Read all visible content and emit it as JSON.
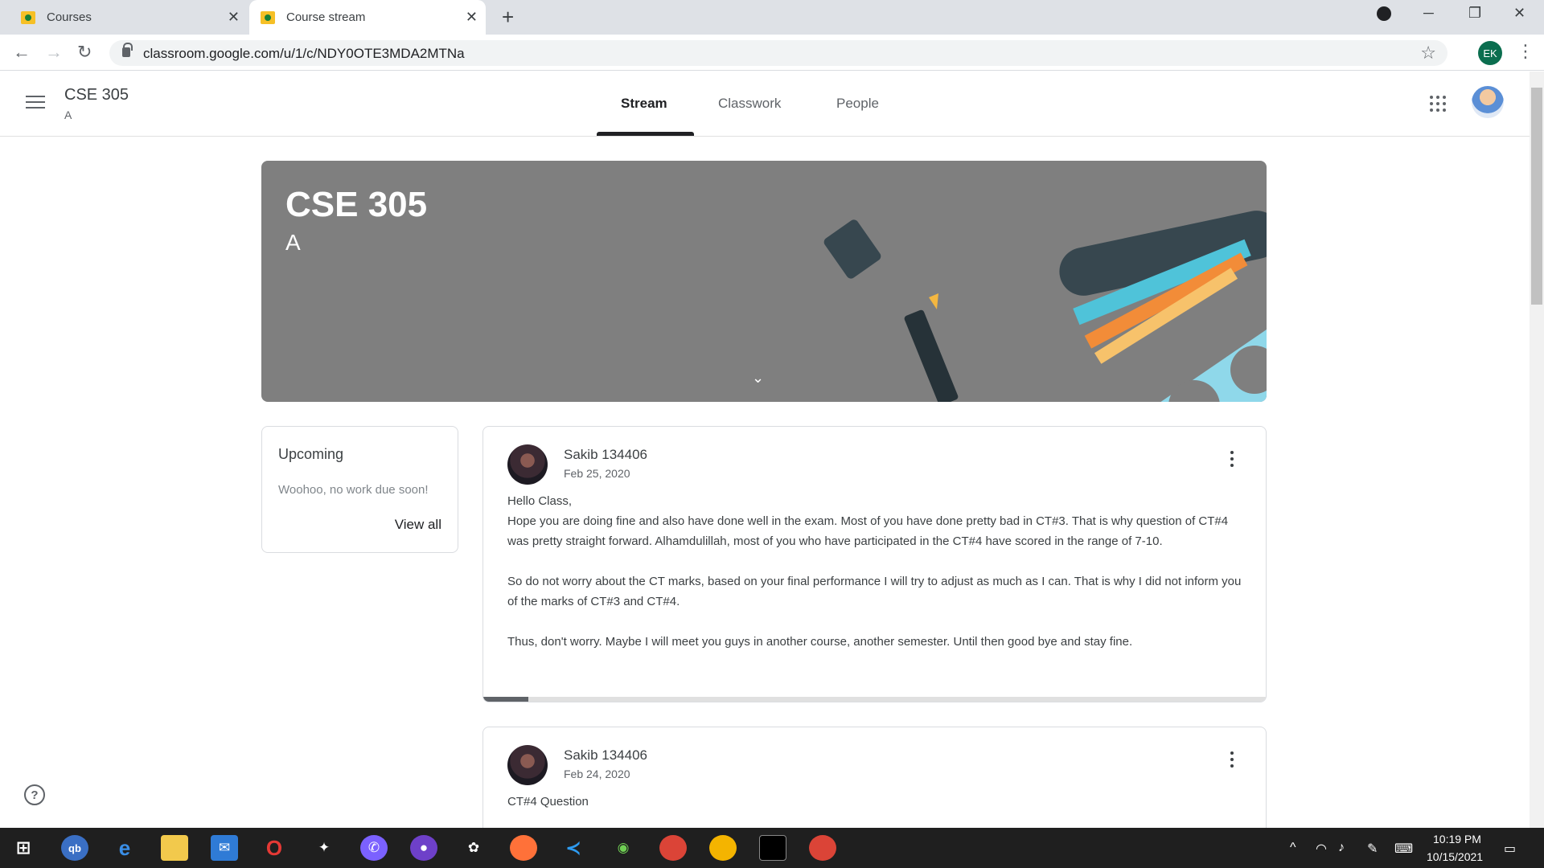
{
  "browser": {
    "tabs": [
      {
        "title": "Courses"
      },
      {
        "title": "Course stream"
      }
    ],
    "url": "classroom.google.com/u/1/c/NDY0OTE3MDA2MTNa",
    "profile_initials": "EK"
  },
  "header": {
    "course_title": "CSE 305",
    "section": "A",
    "tabs": [
      {
        "label": "Stream",
        "active": true
      },
      {
        "label": "Classwork",
        "active": false
      },
      {
        "label": "People",
        "active": false
      }
    ]
  },
  "banner": {
    "title": "CSE 305",
    "section": "A"
  },
  "upcoming": {
    "title": "Upcoming",
    "message": "Woohoo, no work due soon!",
    "view_all": "View all"
  },
  "posts": [
    {
      "author": "Sakib 134406",
      "date": "Feb 25, 2020",
      "body": "Hello Class,\nHope you are doing fine and also have done well in the exam. Most of you have done pretty bad in CT#3. That is why question of CT#4 was pretty straight forward. Alhamdulillah, most of you who have participated in the CT#4 have scored in the range of 7-10.\n\nSo do not worry about the CT marks, based on your final performance I will try to adjust as much as I can. That is why I did not inform you of the marks of CT#3 and CT#4.\n\nThus, don't worry. Maybe I will meet you guys in another course, another semester. Until then good bye and stay fine."
    },
    {
      "author": "Sakib 134406",
      "date": "Feb 24, 2020",
      "body": "CT#4 Question"
    }
  ],
  "taskbar": {
    "time": "10:19 PM",
    "date": "10/15/2021"
  },
  "colors": {
    "banner_bg": "#7f7f7f",
    "accent_dark": "#202124",
    "taskbar": "#1f1f1f"
  }
}
